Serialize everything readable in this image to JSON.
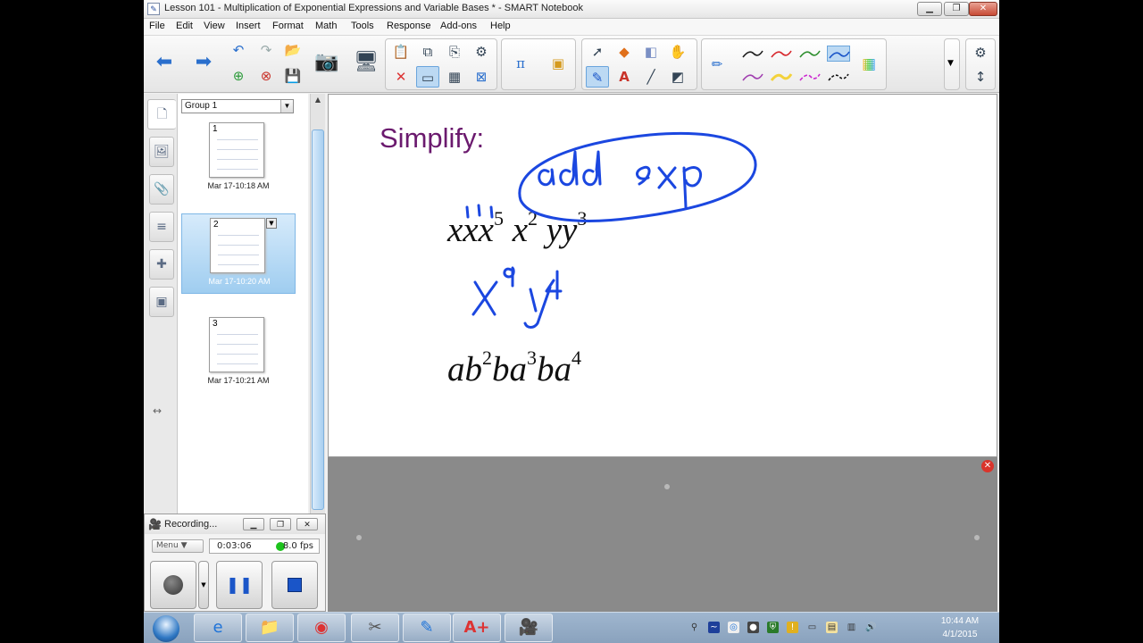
{
  "window": {
    "title": "Lesson 101 - Multiplication of Exponential Expressions and Variable Bases * - SMART Notebook",
    "app_icon": "smart-notebook-icon"
  },
  "menu": [
    "File",
    "Edit",
    "View",
    "Insert",
    "Format",
    "Math",
    "Tools",
    "Response",
    "Add-ons",
    "Help"
  ],
  "toolbar": {
    "icons": [
      "back-arrow-icon",
      "forward-arrow-icon",
      "undo-icon",
      "redo-icon",
      "open-file-icon",
      "add-page-icon",
      "delete-page-icon",
      "save-icon",
      "document-camera-icon",
      "screen-shade-icon",
      "paste-icon",
      "fullscreen-icon",
      "delete-icon",
      "table-icon",
      "math-pi-icon",
      "response-icon",
      "select-arrow-icon",
      "shapes-icon",
      "eraser-icon",
      "magic-pen-icon",
      "pen-icon",
      "text-icon",
      "line-icon",
      "fill-icon",
      "pen-style-icon",
      "color-palette-icon",
      "settings-gear-icon"
    ],
    "pen_colors": [
      "#1f1f1f",
      "#d7262b",
      "#2f8f2f",
      "#1a55c8",
      "#a13fb0",
      "#f3d23b",
      "#cc2bd0",
      "#111111"
    ]
  },
  "sidebar": {
    "group_label": "Group 1",
    "pages": [
      {
        "number": "1",
        "date": "Mar 17-10:18 AM"
      },
      {
        "number": "2",
        "date": "Mar 17-10:20 AM"
      },
      {
        "number": "3",
        "date": "Mar 17-10:21 AM"
      }
    ]
  },
  "page": {
    "heading": "Simplify:",
    "problem1": {
      "text": "xxx",
      "exp1": "5",
      "text2": "x",
      "exp2": "2",
      "text3": "yy",
      "exp3": "3"
    },
    "problem2": {
      "t1": "ab",
      "e1": "2",
      "t2": "ba",
      "e2": "3",
      "t3": "ba",
      "e3": "4"
    },
    "ink_color": "#1b47e0"
  },
  "recorder": {
    "title": "Recording...",
    "menu_label": "Menu",
    "elapsed": "0:03:06",
    "fps": "8.0 fps"
  },
  "taskbar": {
    "time": "10:44 AM",
    "date": "4/1/2015"
  }
}
